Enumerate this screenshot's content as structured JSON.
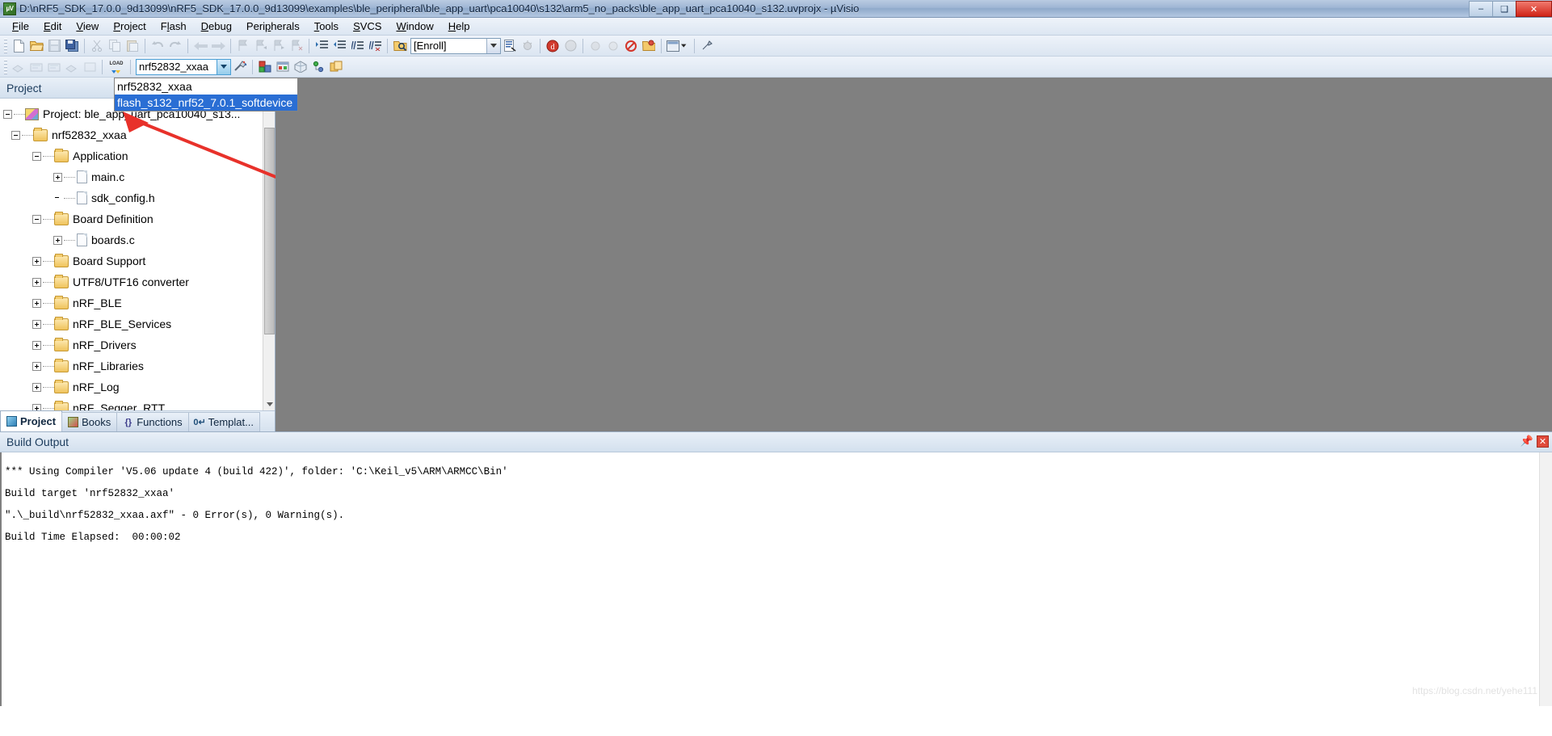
{
  "window": {
    "title": "D:\\nRF5_SDK_17.0.0_9d13099\\nRF5_SDK_17.0.0_9d13099\\examples\\ble_peripheral\\ble_app_uart\\pca10040\\s132\\arm5_no_packs\\ble_app_uart_pca10040_s132.uvprojx - µVisio",
    "app_icon": "uvision-icon",
    "minimize": "–",
    "maximize": "❑",
    "close": "✕"
  },
  "menubar": {
    "items": [
      {
        "label": "File",
        "accel": "F"
      },
      {
        "label": "Edit",
        "accel": "E"
      },
      {
        "label": "View",
        "accel": "V"
      },
      {
        "label": "Project",
        "accel": "P"
      },
      {
        "label": "Flash",
        "accel": "l"
      },
      {
        "label": "Debug",
        "accel": "D"
      },
      {
        "label": "Peripherals",
        "accel": "P"
      },
      {
        "label": "Tools",
        "accel": "T"
      },
      {
        "label": "SVCS",
        "accel": "S"
      },
      {
        "label": "Window",
        "accel": "W"
      },
      {
        "label": "Help",
        "accel": "H"
      }
    ]
  },
  "toolbar_main": {
    "buttons": [
      "new-file-icon",
      "open-file-icon",
      "save-icon",
      "save-all-icon",
      "cut-icon",
      "copy-icon",
      "paste-icon",
      "undo-icon",
      "redo-icon",
      "navigate-back-icon",
      "navigate-forward-icon",
      "bookmark-toggle-icon",
      "bookmark-prev-icon",
      "bookmark-next-icon",
      "bookmark-clear-icon",
      "indent-icon",
      "outdent-icon",
      "comment-icon",
      "uncomment-icon",
      "find-in-files-icon"
    ],
    "enroll": {
      "label": "[Enroll]",
      "options": [
        "[Enroll]"
      ]
    },
    "after_enroll": [
      "configuration-wizard-icon",
      "debug-session-icon",
      "options-target-icon",
      "help-icon"
    ],
    "trailing": [
      "bullet-gray-icon",
      "bullet-gray2-icon",
      "stop-icon",
      "manage-icon",
      "windows-layout-icon",
      "customize-icon"
    ]
  },
  "toolbar_build": {
    "buttons": [
      "translate-icon",
      "build-icon",
      "rebuild-icon",
      "batch-build-icon",
      "stop-build-icon",
      "load-icon"
    ],
    "target_combo": {
      "value": "nrf52832_xxaa",
      "options": [
        "nrf52832_xxaa",
        "flash_s132_nrf52_7.0.1_softdevice"
      ],
      "selected_option_index": 1,
      "dropdown_open": true
    },
    "after_combo": [
      "target-options-icon",
      "manage-project-items-icon",
      "manage-run-time-env-icon",
      "pack-installer-icon",
      "svn-icon",
      "multi-project-icon"
    ]
  },
  "project_pane": {
    "header": "Project",
    "tree": [
      {
        "label": "Project: ble_app_uart_pca10040_s13...",
        "icon": "project-icon",
        "indent": 0,
        "expander": "minus"
      },
      {
        "label": "nrf52832_xxaa",
        "icon": "folder-open-target-icon",
        "indent": 1,
        "expander": "minus"
      },
      {
        "label": "Application",
        "icon": "folder-open-icon",
        "indent": 2,
        "expander": "minus"
      },
      {
        "label": "main.c",
        "icon": "c-file-icon",
        "indent": 3,
        "expander": "plus"
      },
      {
        "label": "sdk_config.h",
        "icon": "h-file-icon",
        "indent": 3,
        "expander": "none"
      },
      {
        "label": "Board Definition",
        "icon": "folder-open-icon",
        "indent": 2,
        "expander": "minus"
      },
      {
        "label": "boards.c",
        "icon": "c-file-icon",
        "indent": 3,
        "expander": "plus"
      },
      {
        "label": "Board Support",
        "icon": "folder-icon",
        "indent": 2,
        "expander": "plus"
      },
      {
        "label": "UTF8/UTF16 converter",
        "icon": "folder-icon",
        "indent": 2,
        "expander": "plus"
      },
      {
        "label": "nRF_BLE",
        "icon": "folder-icon",
        "indent": 2,
        "expander": "plus"
      },
      {
        "label": "nRF_BLE_Services",
        "icon": "folder-icon",
        "indent": 2,
        "expander": "plus"
      },
      {
        "label": "nRF_Drivers",
        "icon": "folder-icon",
        "indent": 2,
        "expander": "plus"
      },
      {
        "label": "nRF_Libraries",
        "icon": "folder-icon",
        "indent": 2,
        "expander": "plus"
      },
      {
        "label": "nRF_Log",
        "icon": "folder-icon",
        "indent": 2,
        "expander": "plus"
      },
      {
        "label": "nRF_Segger_RTT",
        "icon": "folder-icon",
        "indent": 2,
        "expander": "plus"
      }
    ],
    "tabs": [
      {
        "label": "Project",
        "icon": "project-tab-icon",
        "active": true
      },
      {
        "label": "Books",
        "icon": "books-tab-icon",
        "active": false
      },
      {
        "label": "Functions",
        "icon": "functions-tab-icon",
        "active": false
      },
      {
        "label": "Templat...",
        "icon": "templates-tab-icon",
        "active": false
      }
    ]
  },
  "build_output": {
    "title": "Build Output",
    "pin_icon": "pin-icon",
    "close_icon": "close-icon",
    "lines": [
      "*** Using Compiler 'V5.06 update 4 (build 422)', folder: 'C:\\Keil_v5\\ARM\\ARMCC\\Bin'",
      "Build target 'nrf52832_xxaa'",
      "\".\\_build\\nrf52832_xxaa.axf\" - 0 Error(s), 0 Warning(s).",
      "Build Time Elapsed:  00:00:02"
    ]
  },
  "watermark": "https://blog.csdn.net/yehe111",
  "colors": {
    "selection_blue": "#2a6ed4",
    "annotation_red": "#e8312a",
    "editor_gray": "#808080",
    "titlebar_blue": "#9fb6d4"
  }
}
